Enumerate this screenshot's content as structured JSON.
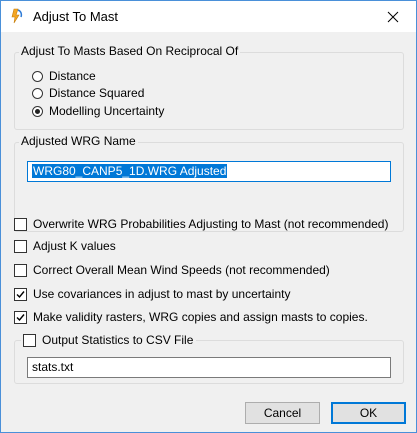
{
  "window": {
    "title": "Adjust To Mast",
    "icons": {
      "app": "app-logo-icon",
      "close": "close-icon"
    }
  },
  "reciprocal_group": {
    "title": "Adjust To Masts Based On Reciprocal Of",
    "options": [
      {
        "label": "Distance",
        "checked": false
      },
      {
        "label": "Distance Squared",
        "checked": false
      },
      {
        "label": "Modelling Uncertainty",
        "checked": true
      }
    ]
  },
  "name_group": {
    "title": "Adjusted WRG Name",
    "value": "WRG80_CANP5_1D.WRG Adjusted"
  },
  "checkboxes": [
    {
      "label": "Overwrite WRG Probabilities Adjusting to Mast (not recommended)",
      "checked": false
    },
    {
      "label": "Adjust K values",
      "checked": false
    },
    {
      "label": "Correct Overall Mean Wind Speeds (not recommended)",
      "checked": false
    },
    {
      "label": "Use covariances in adjust to mast by uncertainty",
      "checked": true
    },
    {
      "label": "Make validity rasters, WRG copies and assign masts to copies.",
      "checked": true
    }
  ],
  "stats_group": {
    "label": "Output Statistics to CSV File",
    "checked": false,
    "value": "stats.txt"
  },
  "buttons": {
    "cancel": "Cancel",
    "ok": "OK"
  },
  "colors": {
    "accent": "#0078d7",
    "window_border": "#4a90d9",
    "background": "#f0f0f0"
  }
}
